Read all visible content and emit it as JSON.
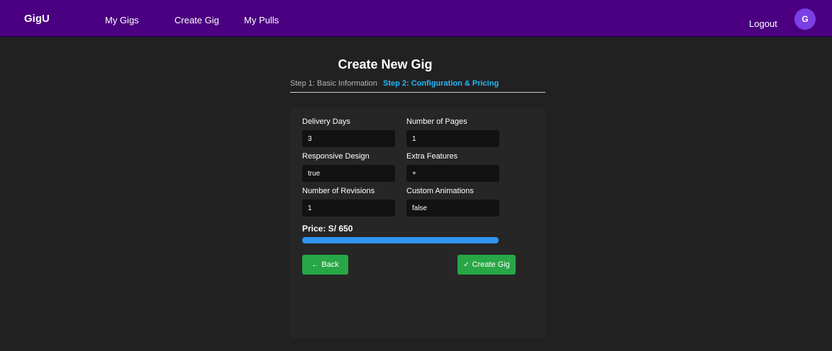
{
  "navbar": {
    "brand": "GigU",
    "links": {
      "my_gigs": "My Gigs",
      "create_gig": "Create Gig",
      "my_pulls": "My Pulls"
    },
    "logout": "Logout",
    "avatar_initial": "G"
  },
  "page": {
    "title": "Create New Gig",
    "steps": [
      {
        "label": "Step 1: Basic Information",
        "active": false
      },
      {
        "label": "Step 2: Configuration & Pricing",
        "active": true
      }
    ]
  },
  "form": {
    "delivery_days": {
      "label": "Delivery Days",
      "value": "3"
    },
    "number_of_pages": {
      "label": "Number of Pages",
      "value": "1"
    },
    "responsive_design": {
      "label": "Responsive Design",
      "value": "true"
    },
    "extra_features": {
      "label": "Extra Features",
      "value": "+"
    },
    "number_of_revisions": {
      "label": "Number of Revisions",
      "value": "1"
    },
    "custom_animations": {
      "label": "Custom Animations",
      "value": "false"
    }
  },
  "price": {
    "text": "Price: S/ 650",
    "progress_percent": 100
  },
  "buttons": {
    "back": {
      "icon": "arrow-left-icon",
      "glyph": "←",
      "label": "Back"
    },
    "create": {
      "icon": "check-icon",
      "glyph": "✓",
      "label": "Create Gig"
    }
  },
  "colors": {
    "navbar_bg": "#4a0080",
    "page_bg": "#212121",
    "card_bg": "#262626",
    "input_bg": "#121212",
    "active_step": "#29b6f6",
    "progress": "#2f95f0",
    "button_green": "#27a745",
    "avatar": "#7b3fe4"
  }
}
